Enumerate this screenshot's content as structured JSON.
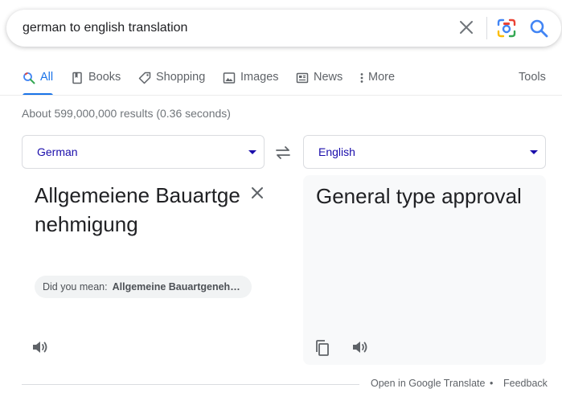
{
  "search": {
    "query": "german to english translation",
    "icons": {
      "clear": "close-icon",
      "lens": "camera-lens-icon",
      "search": "search-icon"
    },
    "colors": {
      "search_icon": "#4285f4"
    }
  },
  "tabs": [
    {
      "label": "All",
      "icon": "search-icon",
      "active": true
    },
    {
      "label": "Books",
      "icon": "book-icon"
    },
    {
      "label": "Shopping",
      "icon": "tag-icon"
    },
    {
      "label": "Images",
      "icon": "image-icon"
    },
    {
      "label": "News",
      "icon": "news-icon"
    },
    {
      "label": "More",
      "icon": "vertical-dots-icon"
    },
    {
      "label": "Tools"
    }
  ],
  "result_stats": "About 599,000,000 results (0.36 seconds)",
  "translator": {
    "source_lang": "German",
    "target_lang": "English",
    "source_text": "Allgemeiene Bauartgenehmigung",
    "did_you_mean_label": "Did you mean:",
    "did_you_mean_value": "Allgemeine Bauartgenehmigung",
    "target_text": "General type approval",
    "colors": {
      "link": "#1a0dab",
      "accent": "#1a73e8",
      "panel_bg": "#f8f9fa"
    }
  },
  "footer": {
    "open_link": "Open in Google Translate",
    "separator": "•",
    "feedback": "Feedback"
  }
}
